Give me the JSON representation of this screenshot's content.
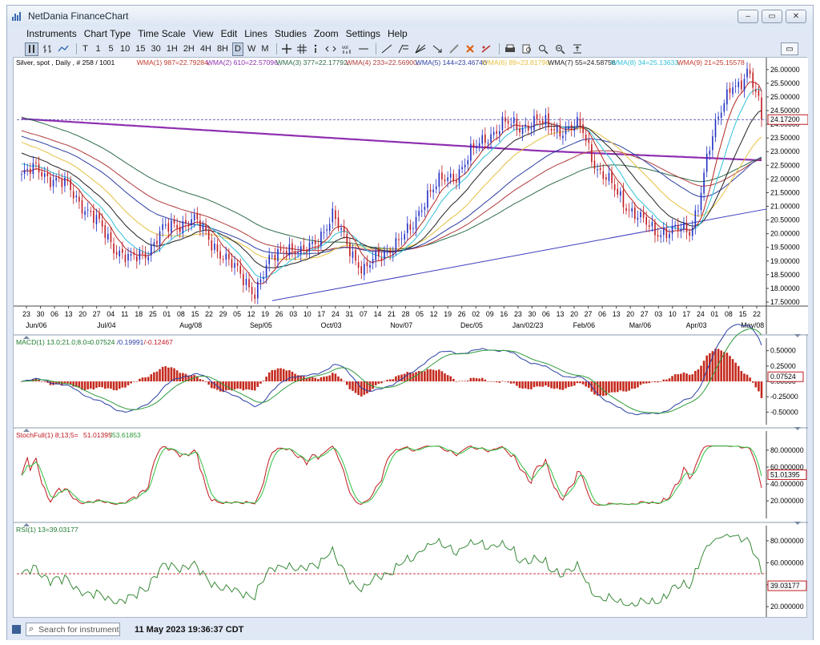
{
  "window": {
    "title": "NetDania FinanceChart",
    "controls": [
      "‒",
      "▭",
      "✕"
    ]
  },
  "menu": [
    "Instruments",
    "Chart Type",
    "Time Scale",
    "View",
    "Edit",
    "Lines",
    "Studies",
    "Zoom",
    "Settings",
    "Help"
  ],
  "toolbar": {
    "chart_types": [
      "bar-icon",
      "ohlc-icon",
      "line-icon"
    ],
    "timescales": [
      "T",
      "1",
      "5",
      "10",
      "15",
      "30",
      "1H",
      "2H",
      "4H",
      "8H",
      "D",
      "W",
      "M"
    ],
    "active_timescale": "D",
    "tools": [
      "crosshair-icon",
      "grid-icon",
      "info-icon",
      "arrows-icon",
      "volume-icon",
      "trendline-icon",
      "fib-icon",
      "fan-icon",
      "arrow-tool-icon",
      "pencil-icon",
      "delete-icon",
      "clear-icon",
      "print-icon",
      "preview-icon",
      "zoom-in-icon",
      "zoom-out-icon",
      "zoom-fit-icon"
    ],
    "right_button": "▭"
  },
  "main_legend": [
    {
      "text": "Silver, spot , Daily , # 258 / 1001",
      "color": "#000000"
    },
    {
      "text": "WMA(1) 987=22.79284,",
      "color": "#c0392b"
    },
    {
      "text": "WMA(2) 610=22.57096,",
      "color": "#8e2fb0"
    },
    {
      "text": "WMA(3) 377=22.17792,",
      "color": "#2e6b4a"
    },
    {
      "text": "WMA(4) 233=22.56900,",
      "color": "#b03a3a"
    },
    {
      "text": "WMA(5) 144=23.46740",
      "color": "#2b3fa3"
    },
    {
      "text": "WMA(6) 89=23.81796,",
      "color": "#e6c040"
    },
    {
      "text": "WMA(7) 55=24.58758",
      "color": "#222222"
    },
    {
      "text": "WMA(8) 34=25.13633,",
      "color": "#2fc0d8"
    },
    {
      "text": "WMA(9) 21=25.15578",
      "color": "#c0392b"
    }
  ],
  "price_axis": [
    "26.00000",
    "25.50000",
    "25.00000",
    "24.50000",
    "24.00000",
    "23.50000",
    "23.00000",
    "22.50000",
    "22.00000",
    "21.50000",
    "21.00000",
    "20.50000",
    "20.00000",
    "19.50000",
    "19.00000",
    "18.50000",
    "18.00000",
    "17.50000"
  ],
  "last_price": "24.17200",
  "date_axis_days": [
    "23",
    "30",
    "06",
    "13",
    "20",
    "27",
    "04",
    "11",
    "18",
    "25",
    "01",
    "08",
    "15",
    "22",
    "29",
    "05",
    "12",
    "19",
    "26",
    "03",
    "10",
    "17",
    "24",
    "31",
    "07",
    "14",
    "21",
    "28",
    "05",
    "12",
    "19",
    "26",
    "02",
    "09",
    "16",
    "23",
    "30",
    "06",
    "13",
    "20",
    "27",
    "06",
    "13",
    "20",
    "27",
    "03",
    "10",
    "17",
    "24",
    "01",
    "08",
    "15",
    "22"
  ],
  "date_axis_months": [
    "Jun/06",
    "Jul/04",
    "Aug/08",
    "Sep/05",
    "Oct/03",
    "Nov/07",
    "Dec/05",
    "Jan/02/23",
    "Feb/06",
    "Mar/06",
    "Apr/03",
    "May/08"
  ],
  "macd": {
    "legend_prefix": "MACD(1) 13.0;21.0;8.0=",
    "legend_v1": "0.07524",
    "legend_v2": "0.19991",
    "legend_v3": "-0.12467",
    "axis": [
      "0.50000",
      "0.25000",
      "0.00000",
      "-0.25000",
      "-0.50000"
    ],
    "last": "0.07524"
  },
  "stoch": {
    "legend_prefix": "StochFull(1) 8;13;5=",
    "legend_v1": "51.01395",
    "legend_v2": "53.61853",
    "axis": [
      "80.000000",
      "60.000000",
      "40.000000",
      "20.000000"
    ],
    "last": "51.01395"
  },
  "rsi": {
    "legend": "RSI(1) 13=39.03177",
    "axis": [
      "80.000000",
      "60.000000",
      "40.000000",
      "20.000000"
    ],
    "last": "39.03177"
  },
  "status": {
    "search_placeholder": "Search for instrument",
    "timestamp": "11 May 2023 19:36:37 CDT"
  },
  "colors": {
    "up": "#1f2fc4",
    "down": "#c0191f",
    "wma1": "#c0392b",
    "wma2": "#8e2fb0",
    "wma3": "#2e6b4a",
    "wma4": "#b03a3a",
    "wma5": "#2b3fa3",
    "wma6": "#e6c040",
    "wma7": "#222222",
    "wma8": "#2fc0d8",
    "wma9": "#b3261e"
  },
  "chart_data": {
    "type": "line",
    "title": "Silver, spot , Daily",
    "close_series": [
      {
        "date": "Jun/06",
        "close": 22.1
      },
      {
        "date": "Jul/04",
        "close": 20.4
      },
      {
        "date": "Jul/25",
        "close": 19.0
      },
      {
        "date": "Aug/08",
        "close": 20.4
      },
      {
        "date": "Sep/05",
        "close": 17.9
      },
      {
        "date": "Oct/03",
        "close": 20.5
      },
      {
        "date": "Oct/17",
        "close": 18.5
      },
      {
        "date": "Nov/07",
        "close": 20.5
      },
      {
        "date": "Dec/05",
        "close": 23.2
      },
      {
        "date": "Jan/02/23",
        "close": 24.1
      },
      {
        "date": "Jan/30",
        "close": 23.5
      },
      {
        "date": "Feb/06",
        "close": 22.5
      },
      {
        "date": "Mar/06",
        "close": 20.6
      },
      {
        "date": "Mar/13",
        "close": 20.2
      },
      {
        "date": "Apr/03",
        "close": 24.5
      },
      {
        "date": "Apr/17",
        "close": 25.3
      },
      {
        "date": "May/08",
        "close": 25.9
      },
      {
        "date": "May/10",
        "close": 24.17
      }
    ],
    "ylim": [
      17.5,
      26.2
    ],
    "grid": false
  }
}
